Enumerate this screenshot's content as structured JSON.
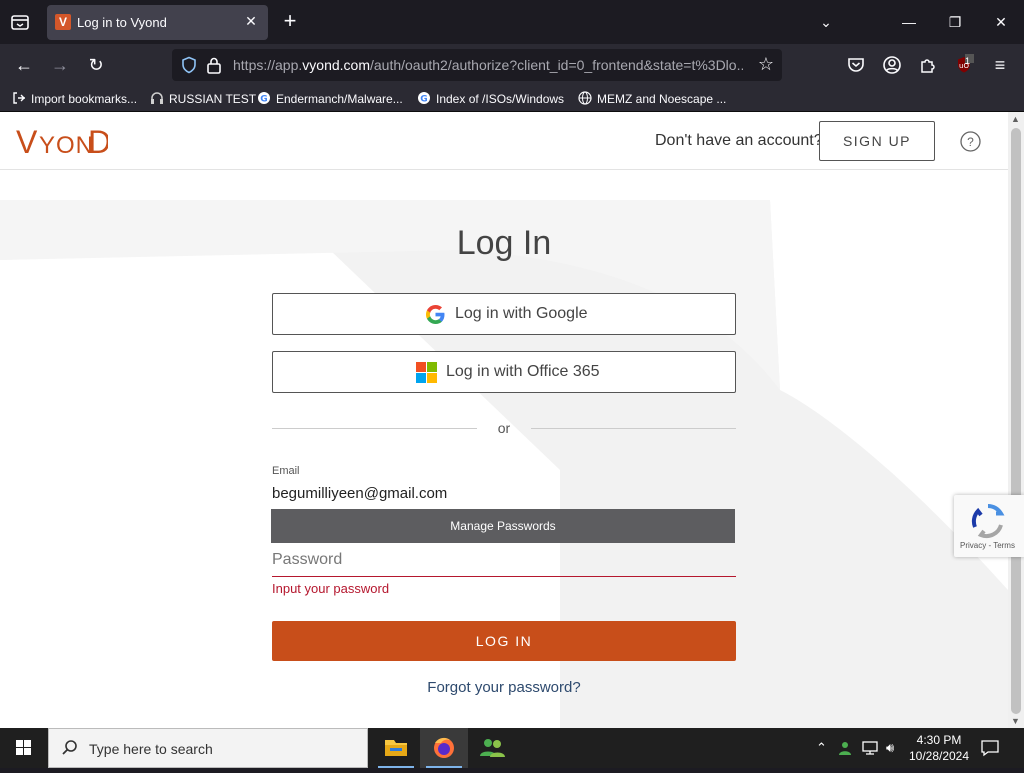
{
  "browser": {
    "tab": {
      "title": "Log in to Vyond",
      "favicon_letter": "V"
    },
    "url": {
      "prefix": "https://app.",
      "domain": "vyond.com",
      "path": "/auth/oauth2/authorize?client_id=0_frontend&state=t%3Dlo..."
    },
    "extensions_badge": "1",
    "bookmarks": [
      {
        "label": "Import bookmarks...",
        "icon": "import-icon"
      },
      {
        "label": "RUSSIAN TEST",
        "icon": "headphones-icon"
      },
      {
        "label": "Endermanch/Malware...",
        "icon": "google-icon"
      },
      {
        "label": "Index of /ISOs/Windows",
        "icon": "google-icon"
      },
      {
        "label": "MEMZ and Noescape ...",
        "icon": "globe-icon"
      }
    ]
  },
  "site": {
    "logo_text": "VYOND",
    "no_account_text": "Don't have an account?",
    "signup_label": "SIGN UP",
    "help_icon": "question-icon"
  },
  "login": {
    "title": "Log In",
    "google_label": "Log in with Google",
    "office_label": "Log in with Office 365",
    "or_text": "or",
    "email_label": "Email",
    "email_value": "begumilliyeen@gmail.com",
    "manage_passwords": "Manage Passwords",
    "password_placeholder": "Password",
    "password_error": "Input your password",
    "login_button": "LOG IN",
    "forgot_link": "Forgot your password?"
  },
  "recaptcha": {
    "links": "Privacy - Terms"
  },
  "taskbar": {
    "search_placeholder": "Type here to search",
    "time": "4:30 PM",
    "date": "10/28/2024"
  },
  "colors": {
    "brand_orange": "#c84e1a",
    "error_red": "#b5172e",
    "link_blue": "#2e4a6e"
  }
}
